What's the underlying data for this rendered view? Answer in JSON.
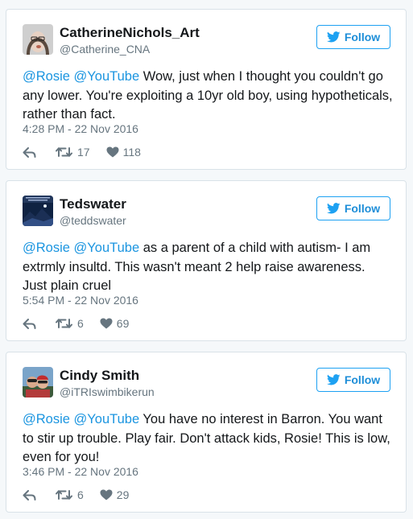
{
  "tweets": [
    {
      "name": "CatherineNichols_Art",
      "handle": "@Catherine_CNA",
      "follow_label": "Follow",
      "mention1": "@Rosie",
      "mention2": "@YouTube",
      "text": " Wow, just when I thought you couldn't go any lower. You're exploiting a 10yr old boy, using hypotheticals, rather than fact.",
      "timestamp": "4:28 PM - 22 Nov 2016",
      "retweets": "17",
      "likes": "118"
    },
    {
      "name": "Tedswater",
      "handle": "@teddswater",
      "follow_label": "Follow",
      "mention1": "@Rosie",
      "mention2": "@YouTube",
      "text": " as a parent of a child with autism- I am extrmly insultd. This wasn't meant 2 help raise awareness. Just plain cruel",
      "timestamp": "5:54 PM - 22 Nov 2016",
      "retweets": "6",
      "likes": "69"
    },
    {
      "name": "Cindy Smith",
      "handle": "@iTRIswimbikerun",
      "follow_label": "Follow",
      "mention1": "@Rosie",
      "mention2": "@YouTube",
      "text": " You have no interest in Barron. You want to stir up trouble. Play fair. Don't attack kids, Rosie! This is low, even for you!",
      "timestamp": "3:46 PM - 22 Nov 2016",
      "retweets": "6",
      "likes": "29"
    }
  ],
  "colors": {
    "link": "#1b95e0",
    "follow_border": "#1da1f2",
    "muted": "#66757f"
  },
  "icons": {
    "follow": "twitter-bird-icon",
    "reply": "reply-icon",
    "retweet": "retweet-icon",
    "like": "heart-icon"
  }
}
